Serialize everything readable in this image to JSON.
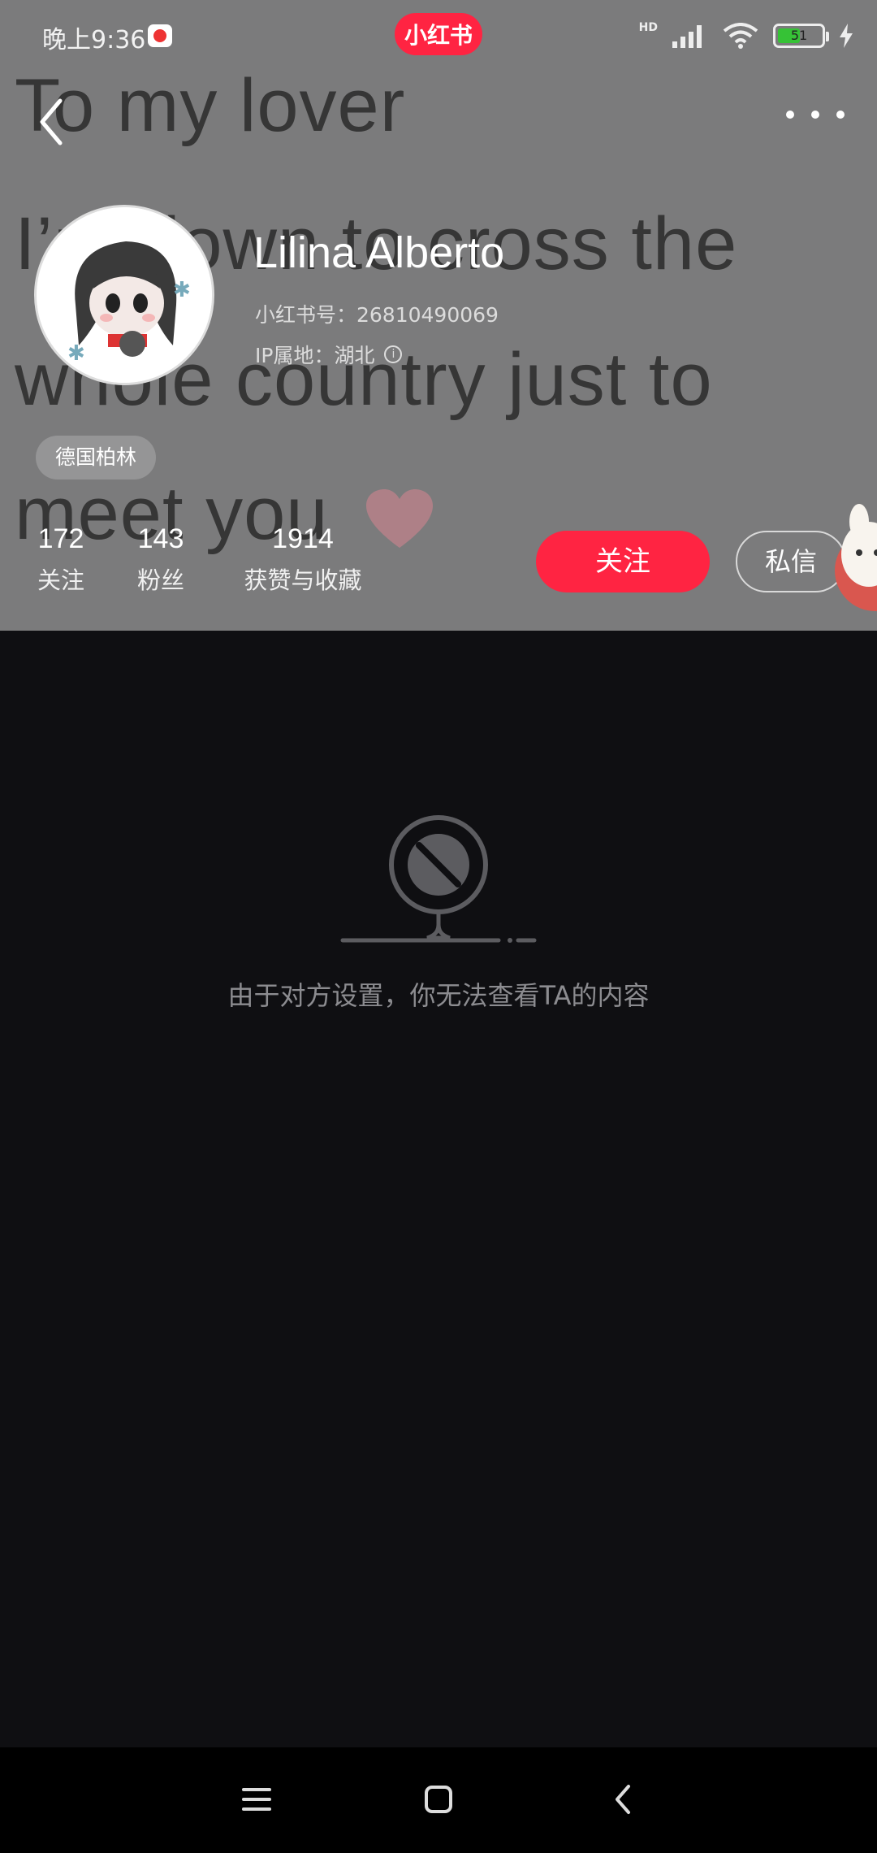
{
  "status_bar": {
    "time": "晚上9:36",
    "app_brand": "小红书",
    "network": "HD",
    "battery_level": "51",
    "battery_fraction": 0.51
  },
  "background_text": {
    "line1": "To my lover",
    "line2": "I’m down to cross the",
    "line3": "whole country just to",
    "line4": "meet you"
  },
  "profile": {
    "name": "Lilina Alberto",
    "red_id": "小红书号：26810490069",
    "ip_location": "IP属地：湖北",
    "tag": "德国柏林"
  },
  "stats": [
    {
      "value": "172",
      "label": "关注"
    },
    {
      "value": "143",
      "label": "粉丝"
    },
    {
      "value": "1914",
      "label": "获赞与收藏"
    }
  ],
  "actions": {
    "follow": "关注",
    "message": "私信"
  },
  "empty_state": {
    "message": "由于对方设置，你无法查看TA的内容"
  },
  "icons": {
    "back": "back-chevron-icon",
    "more": "more-dots-icon",
    "info": "info-icon",
    "empty": "blocked-camera-icon",
    "nav_menu": "menu-icon",
    "nav_home": "home-square-icon",
    "nav_back": "back-triangle-icon"
  },
  "colors": {
    "brand": "#ff2442",
    "header_bg": "#7b7b7c",
    "page_bg": "#0f0f12",
    "empty_text": "#8c8c90"
  }
}
